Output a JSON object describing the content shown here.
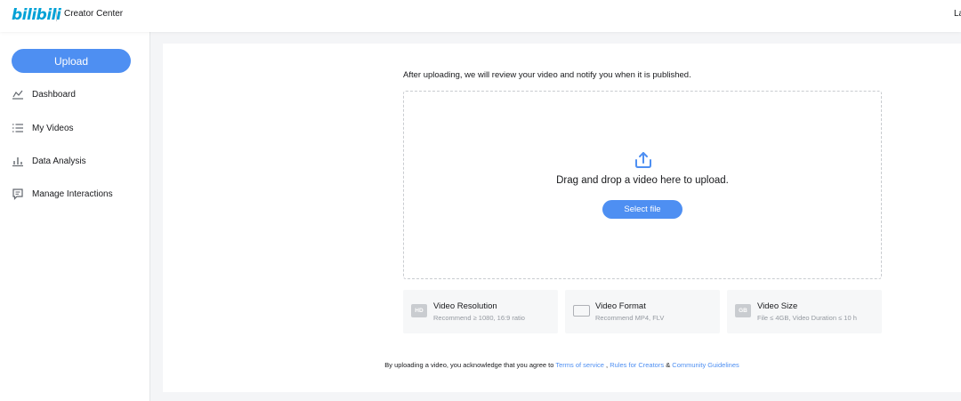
{
  "header": {
    "logo_text": "bilibili",
    "subtitle": "Creator Center",
    "right_text": "La"
  },
  "sidebar": {
    "upload_label": "Upload",
    "items": [
      {
        "label": "Dashboard",
        "icon": "line-chart-icon"
      },
      {
        "label": "My Videos",
        "icon": "list-icon"
      },
      {
        "label": "Data Analysis",
        "icon": "bar-chart-icon"
      },
      {
        "label": "Manage Interactions",
        "icon": "comment-icon"
      }
    ]
  },
  "main": {
    "notice": "After uploading, we will review your video and notify you when it is published.",
    "dropzone": {
      "icon": "upload-cloud-icon",
      "text": "Drag and drop a video here to upload.",
      "button_label": "Select file"
    },
    "requirements": [
      {
        "badge": "HD",
        "title": "Video Resolution",
        "subtitle": "Recommend ≥ 1080, 16:9 ratio"
      },
      {
        "badge": "",
        "title": "Video Format",
        "subtitle": "Recommend MP4, FLV"
      },
      {
        "badge": "GB",
        "title": "Video Size",
        "subtitle": "File ≤ 4GB, Video Duration ≤ 10 h"
      }
    ],
    "agreement": {
      "prefix": "By uploading a video, you acknowledge that you agree to",
      "terms": "Terms of service",
      "sep1": ",",
      "rules": "Rules for Creators",
      "amp": "&",
      "guidelines": "Community Guidelines"
    }
  },
  "colors": {
    "accent": "#4e8ff2",
    "brand": "#00a1d6",
    "background": "#f4f5f7",
    "muted_text": "#9499a0"
  }
}
